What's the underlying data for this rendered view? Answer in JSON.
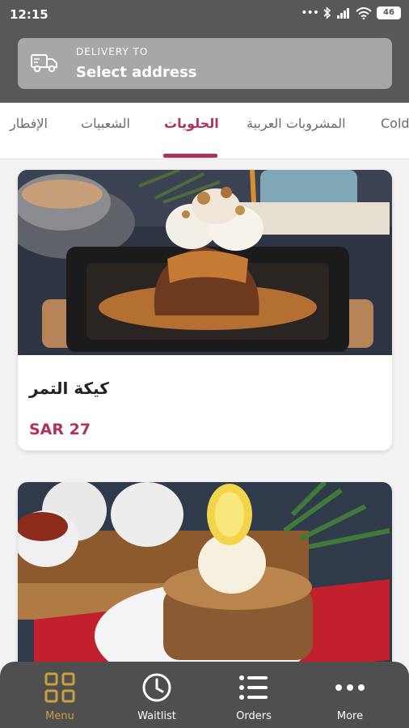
{
  "status_bar": {
    "time": "12:15",
    "battery": "46"
  },
  "header": {
    "delivery_label": "DELIVERY TO",
    "address": "Select address"
  },
  "tabs": [
    {
      "label": "الإفطار",
      "active": false
    },
    {
      "label": "الشعبيات",
      "active": false
    },
    {
      "label": "الحلويات",
      "active": true
    },
    {
      "label": "المشروبات العربية",
      "active": false
    },
    {
      "label": "Cold",
      "active": false
    }
  ],
  "products": [
    {
      "name": "كيكة التمر",
      "price": "SAR 27"
    }
  ],
  "bottom_nav": [
    {
      "label": "Menu",
      "icon": "grid-icon",
      "active": true
    },
    {
      "label": "Waitlist",
      "icon": "clock-icon",
      "active": false
    },
    {
      "label": "Orders",
      "icon": "list-icon",
      "active": false
    },
    {
      "label": "More",
      "icon": "more-dots-icon",
      "active": false
    }
  ],
  "colors": {
    "accent": "#b0305f",
    "nav_active": "#c8a13f",
    "header_bg": "#585858"
  }
}
